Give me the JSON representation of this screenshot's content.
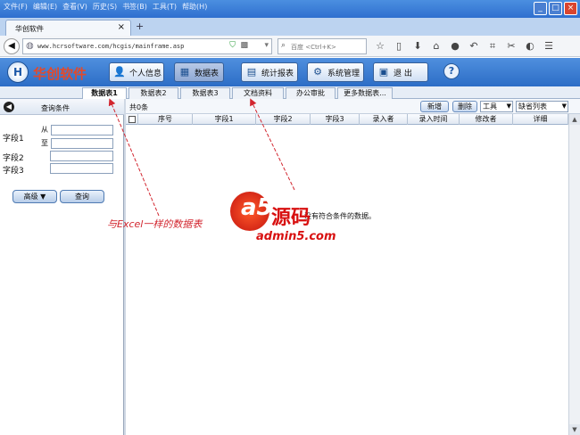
{
  "menu": [
    "文件(F)",
    "编辑(E)",
    "查看(V)",
    "历史(S)",
    "书签(B)",
    "工具(T)",
    "帮助(H)"
  ],
  "window_buttons": [
    "_",
    "□",
    "×"
  ],
  "browser_tab": {
    "title": "华创软件",
    "close": "×",
    "new_tab": "+"
  },
  "nav": {
    "back": "◀",
    "url": "www.hcrsoftware.com/hcgis/mainframe.asp",
    "search_placeholder": "百度 <Ctrl+K>"
  },
  "app": {
    "logo_text": "华创软件",
    "logo_mark": "H",
    "header_buttons": [
      {
        "label": "个人信息",
        "icon": "person-icon",
        "glyph": "👤"
      },
      {
        "label": "数据表",
        "icon": "table-icon",
        "glyph": "▦"
      },
      {
        "label": "统计报表",
        "icon": "report-icon",
        "glyph": "▤"
      },
      {
        "label": "系统管理",
        "icon": "gear-icon",
        "glyph": "⚙"
      },
      {
        "label": "退  出",
        "icon": "exit-icon",
        "glyph": "▣"
      }
    ],
    "help": "?"
  },
  "sheet_tabs": [
    "数据表1",
    "数据表2",
    "数据表3",
    "文档资料",
    "办公审批",
    "更多数据表..."
  ],
  "left_panel": {
    "title": "查询条件",
    "collapse": "◀",
    "fields": [
      {
        "label": "字段1",
        "from_label": "从",
        "to_label": "至"
      },
      {
        "label": "字段2"
      },
      {
        "label": "字段3"
      }
    ],
    "advanced_button": "高级 ▼",
    "query_button": "查询"
  },
  "grid": {
    "record_count": "共0条",
    "add_button": "新增",
    "delete_button": "删除",
    "tools_select": "工具",
    "view_select": "缺省列表",
    "columns": [
      "序号",
      "字段1",
      "字段2",
      "字段3",
      "录入者",
      "录入时间",
      "修改者",
      "详细"
    ],
    "empty_message": "没有符合条件的数据。"
  },
  "annotation": "与Excel一样的数据表",
  "watermark": {
    "mark": "a5",
    "text": "源码",
    "url": "admin5.com"
  }
}
